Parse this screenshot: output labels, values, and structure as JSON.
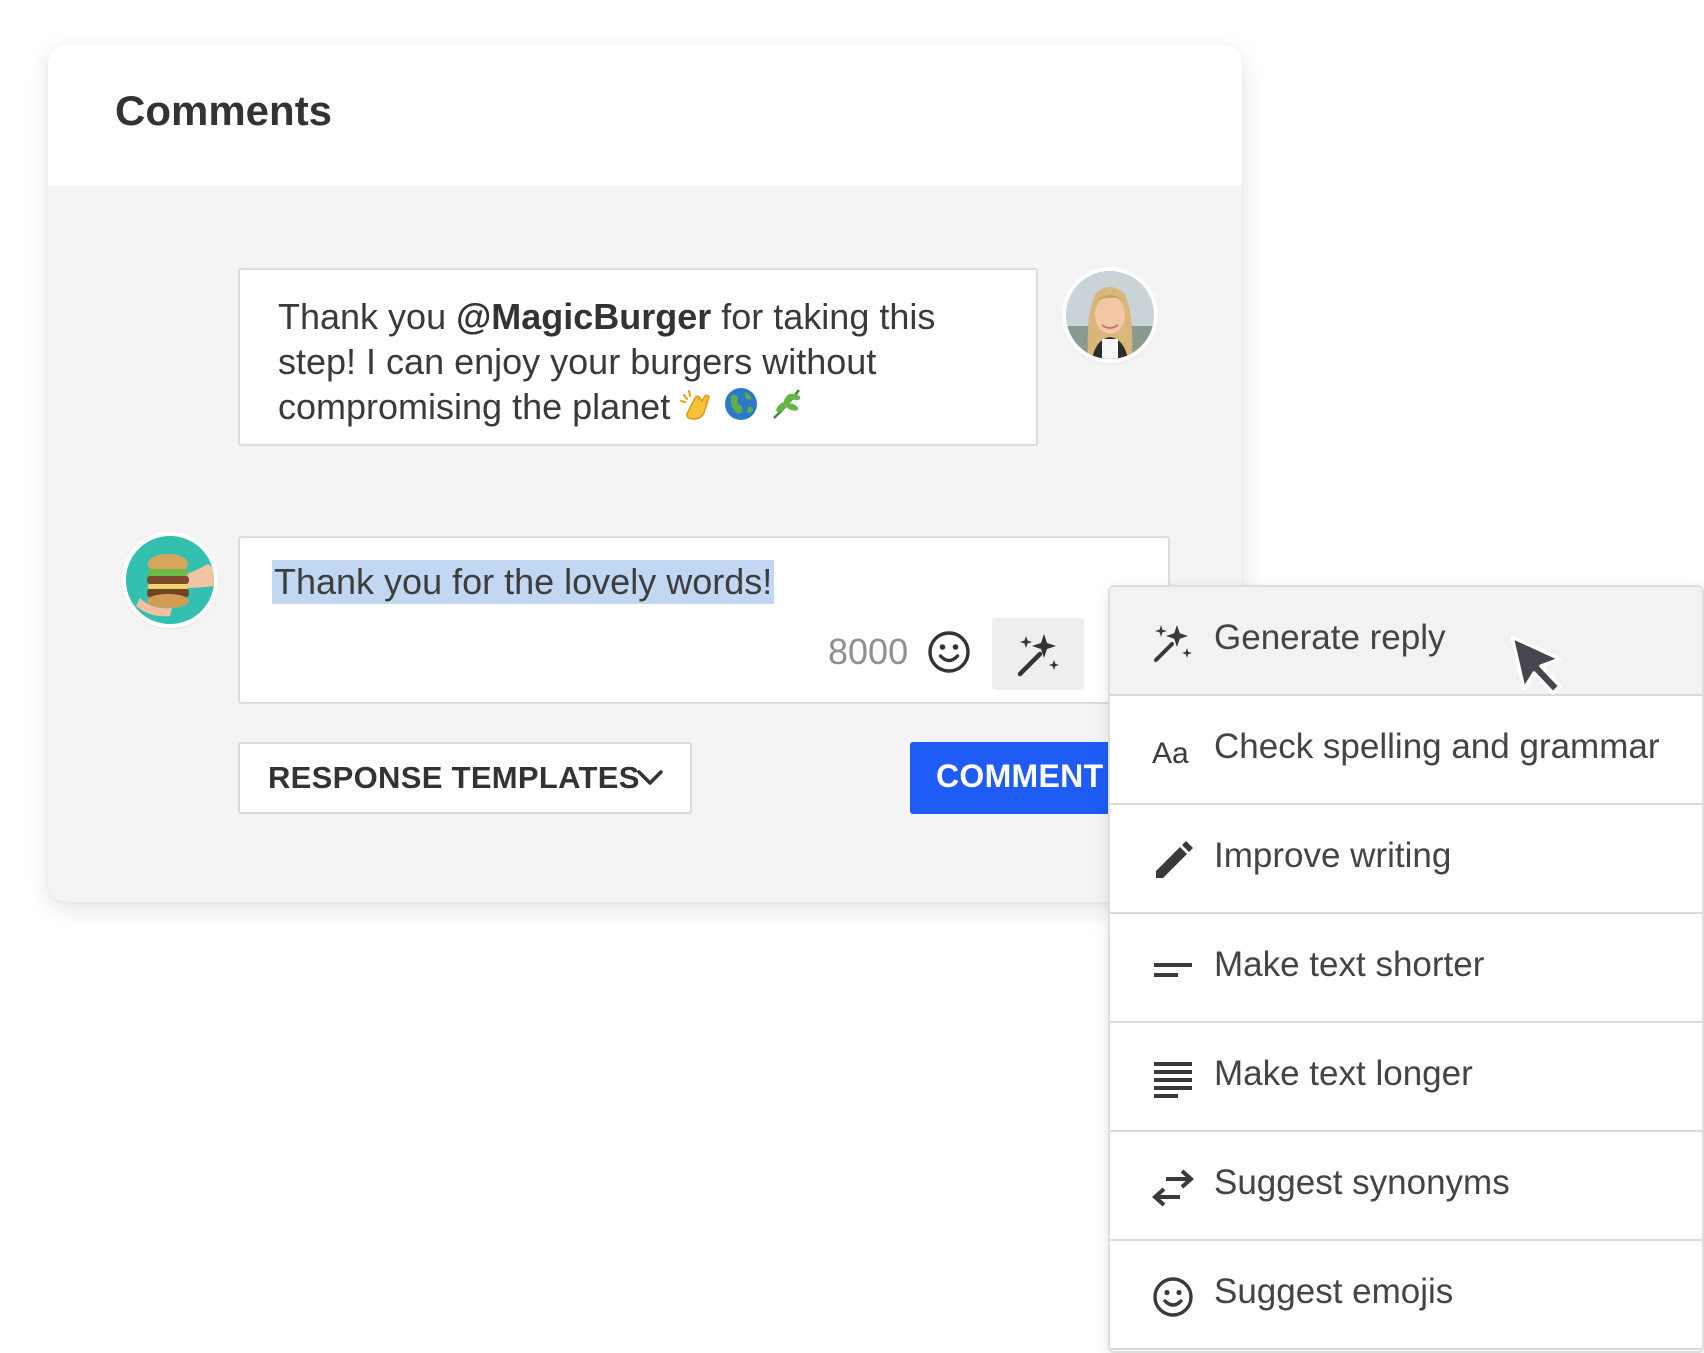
{
  "panel": {
    "title": "Comments"
  },
  "comment": {
    "text_before": "Thank you ",
    "mention": "@MagicBurger",
    "text_after": " for taking this step! I can enjoy your burgers without compromising the planet",
    "emojis": [
      "clapping-hands",
      "globe",
      "herb"
    ]
  },
  "reply": {
    "text": "Thank you for the lovely words!",
    "char_count": "8000"
  },
  "actions": {
    "templates_label": "RESPONSE TEMPLATES",
    "comment_label": "COMMENT"
  },
  "menu": {
    "items": [
      {
        "label": "Generate reply",
        "icon": "magic-sparkle-icon"
      },
      {
        "label": "Check spelling and grammar",
        "icon": "text-aa-icon"
      },
      {
        "label": "Improve writing",
        "icon": "pencil-icon"
      },
      {
        "label": "Make text shorter",
        "icon": "short-text-icon"
      },
      {
        "label": "Make text longer",
        "icon": "long-text-icon"
      },
      {
        "label": "Suggest synonyms",
        "icon": "swap-arrows-icon"
      },
      {
        "label": "Suggest emojis",
        "icon": "smiley-icon"
      }
    ],
    "active_item": "Generate reply"
  },
  "colors": {
    "primary_button": "#1f5cf5",
    "selection": "#c2d7f2"
  }
}
